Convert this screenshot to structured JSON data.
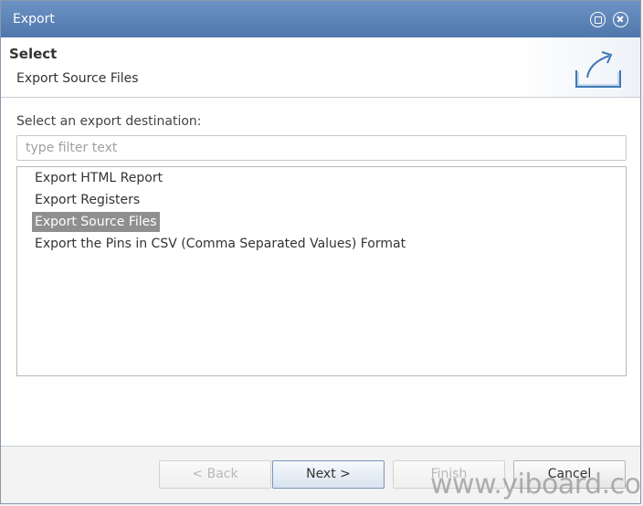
{
  "window": {
    "title": "Export"
  },
  "header": {
    "title": "Select",
    "subtitle": "Export Source Files"
  },
  "main": {
    "destination_label": "Select an export destination:",
    "filter_placeholder": "type filter text",
    "items": [
      {
        "label": "Export HTML Report",
        "selected": false
      },
      {
        "label": "Export Registers",
        "selected": false
      },
      {
        "label": "Export Source Files",
        "selected": true
      },
      {
        "label": "Export the Pins in CSV (Comma Separated Values) Format",
        "selected": false
      }
    ]
  },
  "buttons": {
    "back": "< Back",
    "next": "Next >",
    "finish": "Finish",
    "cancel": "Cancel"
  },
  "watermark": "www.yiboard.com",
  "colors": {
    "titlebar": "#5a82b8",
    "selection": "#8f8f8f",
    "icon": "#3f78b5"
  }
}
